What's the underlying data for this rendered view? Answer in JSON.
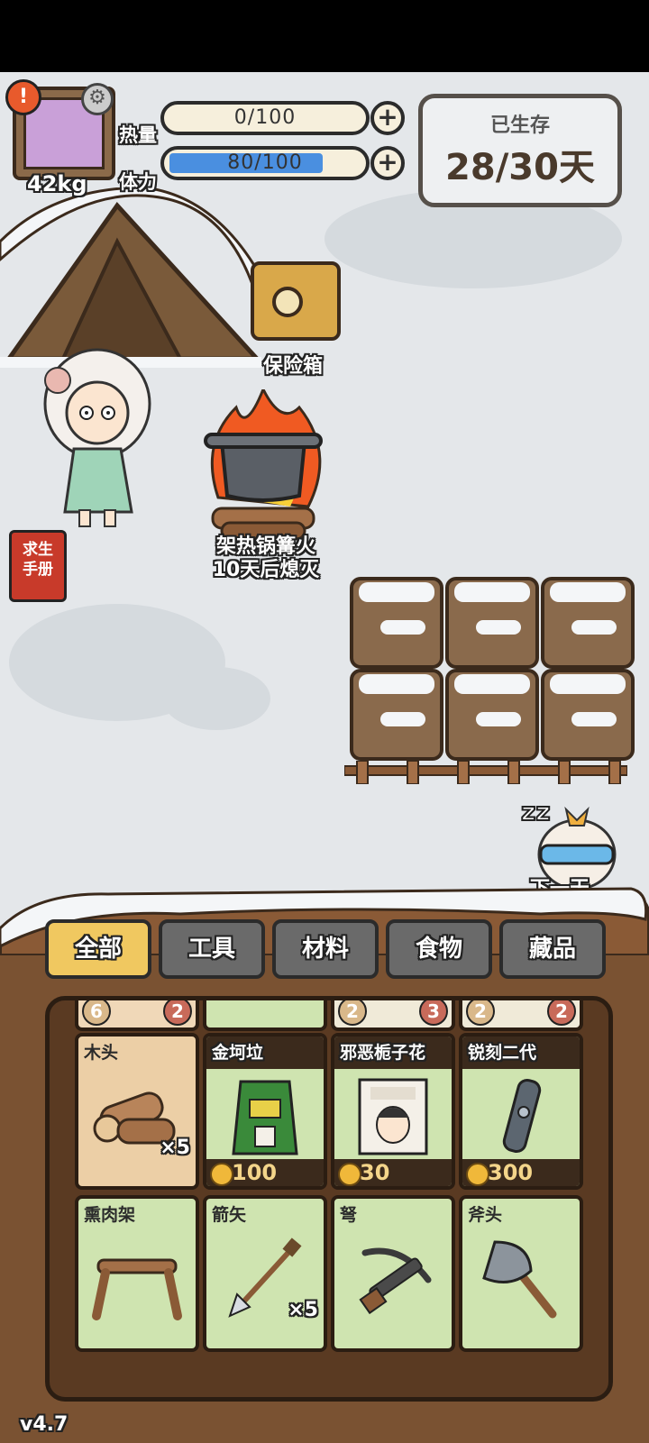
{
  "hud": {
    "weight": "42kg",
    "calories_label": "热量",
    "stamina_label": "体力",
    "calories_text": "0/100",
    "calories_fraction": 0.0,
    "stamina_text": "80/100",
    "stamina_fraction": 0.8,
    "plus_symbol": "+",
    "alert_symbol": "!",
    "survival_title": "已生存",
    "survival_days": "28/30天"
  },
  "scene": {
    "safe_label": "保险箱",
    "fire_label_line1": "架热锅篝火",
    "fire_label_line2": "10天后熄灭",
    "manual_line1": "求生",
    "manual_line2": "手册",
    "sleep_label": "下一天"
  },
  "tabs": [
    {
      "label": "全部",
      "active": true
    },
    {
      "label": "工具",
      "active": false
    },
    {
      "label": "材料",
      "active": false
    },
    {
      "label": "食物",
      "active": false
    },
    {
      "label": "藏品",
      "active": false
    }
  ],
  "partial_row": [
    {
      "left_badge": "6",
      "right_badge": "2"
    },
    {
      "left_badge": "",
      "right_badge": ""
    },
    {
      "left_badge": "2",
      "right_badge": "3"
    },
    {
      "left_badge": "2",
      "right_badge": "2"
    }
  ],
  "items": [
    {
      "name": "木头",
      "qty": "×5",
      "price": "",
      "icon": "wood-log-icon"
    },
    {
      "name": "金坷垃",
      "qty": "",
      "price": "100",
      "icon": "fertilizer-bag-icon"
    },
    {
      "name": "邪恶栀子花",
      "qty": "",
      "price": "30",
      "icon": "poster-icon"
    },
    {
      "name": "锐刻二代",
      "qty": "",
      "price": "300",
      "icon": "e-cigarette-icon"
    },
    {
      "name": "熏肉架",
      "qty": "",
      "price": "",
      "icon": "smoking-rack-icon"
    },
    {
      "name": "箭矢",
      "qty": "×5",
      "price": "",
      "icon": "arrow-icon"
    },
    {
      "name": "弩",
      "qty": "",
      "price": "",
      "icon": "crossbow-icon"
    },
    {
      "name": "斧头",
      "qty": "",
      "price": "",
      "icon": "axe-icon"
    }
  ],
  "version": "v4.7",
  "colors": {
    "snow": "#e4e7ea",
    "wood": "#7a5232",
    "tab_active": "#f0c860",
    "stamina_bar": "#4a8fe0"
  }
}
